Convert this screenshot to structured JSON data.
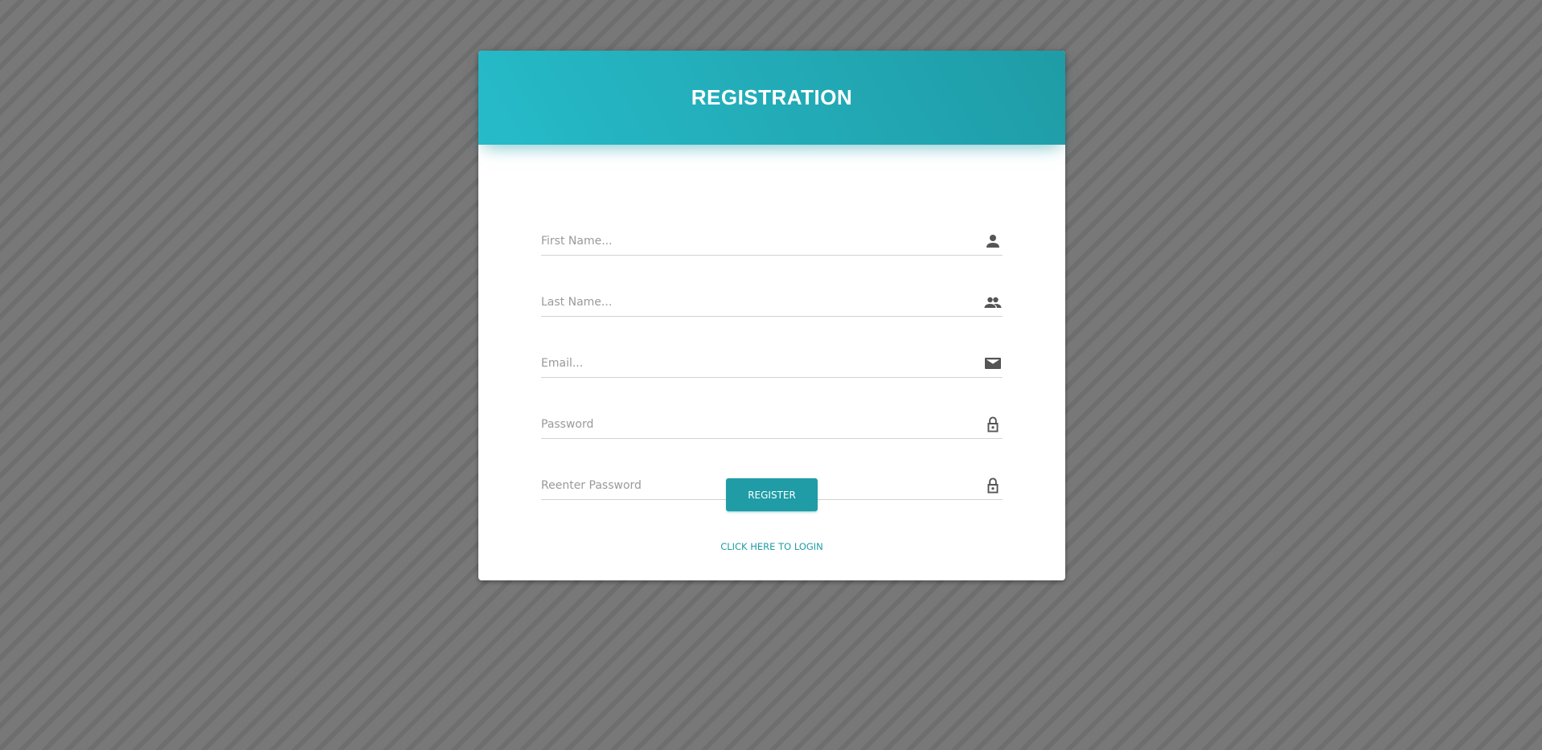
{
  "header": {
    "title": "REGISTRATION"
  },
  "form": {
    "fields": [
      {
        "placeholder": "First Name...",
        "value": "",
        "icon": "person-icon"
      },
      {
        "placeholder": "Last Name...",
        "value": "",
        "icon": "people-icon"
      },
      {
        "placeholder": "Email...",
        "value": "",
        "icon": "mail-icon"
      },
      {
        "placeholder": "Password",
        "value": "",
        "icon": "lock-icon"
      },
      {
        "placeholder": "Reenter Password",
        "value": "",
        "icon": "lock-icon"
      }
    ],
    "register_label": "REGISTER",
    "login_link_label": "CLICK HERE TO LOGIN"
  },
  "colors": {
    "accent": "#1f9ca6",
    "header_gradient_start": "#26bbc9",
    "header_gradient_end": "#1f9ca6",
    "background": "#747474"
  }
}
